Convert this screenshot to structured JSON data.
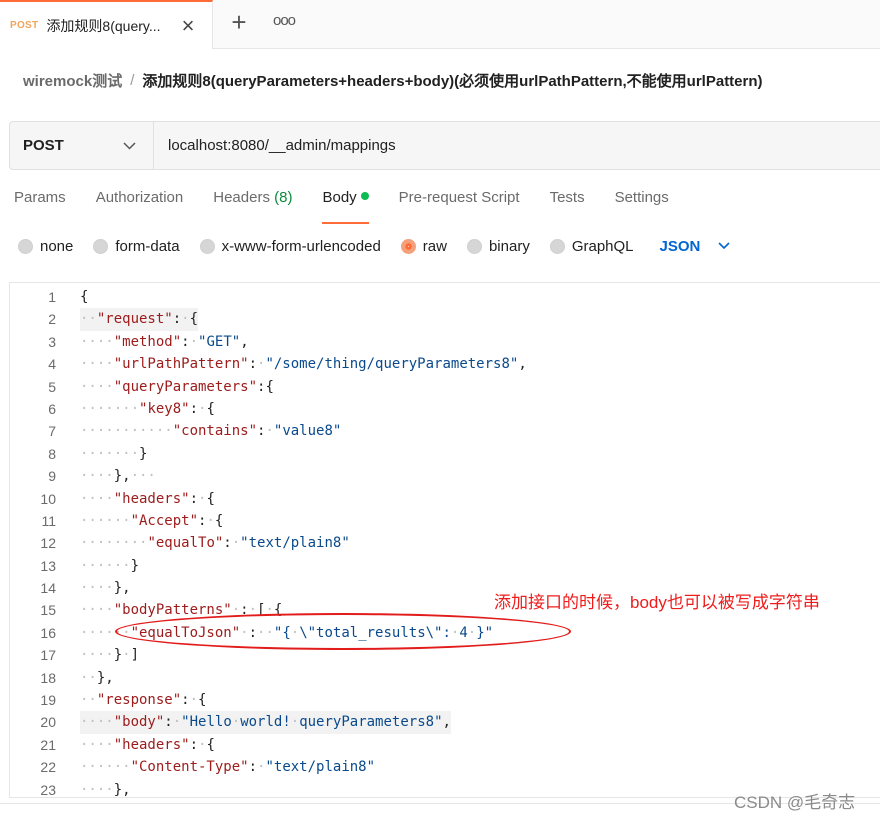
{
  "tab": {
    "method": "POST",
    "title": "添加规则8(query...",
    "close_icon": "close-icon"
  },
  "breadcrumb": {
    "parent": "wiremock测试",
    "separator": "/",
    "current": "添加规则8(queryParameters+headers+body)(必须使用urlPathPattern,不能使用urlPattern)"
  },
  "request": {
    "method": "POST",
    "url": "localhost:8080/__admin/mappings"
  },
  "request_tabs": [
    {
      "label": "Params"
    },
    {
      "label": "Authorization"
    },
    {
      "label": "Headers",
      "count": "(8)"
    },
    {
      "label": "Body",
      "active": true
    },
    {
      "label": "Pre-request Script"
    },
    {
      "label": "Tests"
    },
    {
      "label": "Settings"
    }
  ],
  "body_options": [
    {
      "label": "none",
      "selected": false
    },
    {
      "label": "form-data",
      "selected": false
    },
    {
      "label": "x-www-form-urlencoded",
      "selected": false
    },
    {
      "label": "raw",
      "selected": true
    },
    {
      "label": "binary",
      "selected": false
    },
    {
      "label": "GraphQL",
      "selected": false
    }
  ],
  "format": "JSON",
  "code_lines": [
    {
      "n": "1",
      "t": "{"
    },
    {
      "n": "2",
      "t": "··\"request\":·{"
    },
    {
      "n": "3",
      "t": "····\"method\":·\"GET\","
    },
    {
      "n": "4",
      "t": "····\"urlPathPattern\":·\"/some/thing/queryParameters8\","
    },
    {
      "n": "5",
      "t": "····\"queryParameters\":{"
    },
    {
      "n": "6",
      "t": "·······\"key8\":·{"
    },
    {
      "n": "7",
      "t": "···········\"contains\":·\"value8\""
    },
    {
      "n": "8",
      "t": "·······}"
    },
    {
      "n": "9",
      "t": "····},···"
    },
    {
      "n": "10",
      "t": "····\"headers\":·{"
    },
    {
      "n": "11",
      "t": "······\"Accept\":·{"
    },
    {
      "n": "12",
      "t": "········\"equalTo\":·\"text/plain8\""
    },
    {
      "n": "13",
      "t": "······}"
    },
    {
      "n": "14",
      "t": "····},"
    },
    {
      "n": "15",
      "t": "····\"bodyPatterns\"·:·[·{"
    },
    {
      "n": "16",
      "t": "······\"equalToJson\"·:··\"{·\\\"total_results\\\":·4·}\""
    },
    {
      "n": "17",
      "t": "····}·]"
    },
    {
      "n": "18",
      "t": "··},"
    },
    {
      "n": "19",
      "t": "··\"response\":·{"
    },
    {
      "n": "20",
      "t": "····\"body\":·\"Hello·world!·queryParameters8\","
    },
    {
      "n": "21",
      "t": "····\"headers\":·{"
    },
    {
      "n": "22",
      "t": "······\"Content-Type\":·\"text/plain8\""
    },
    {
      "n": "23",
      "t": "····},"
    }
  ],
  "annotation": "添加接口的时候，body也可以被写成字符串",
  "watermark": "CSDN @毛奇志",
  "colors": {
    "accent": "#ff6c37",
    "json_blue": "#0265d2",
    "key": "#9c1b1b",
    "string": "#0a4a8c",
    "annotation_red": "#ef1c1c"
  }
}
